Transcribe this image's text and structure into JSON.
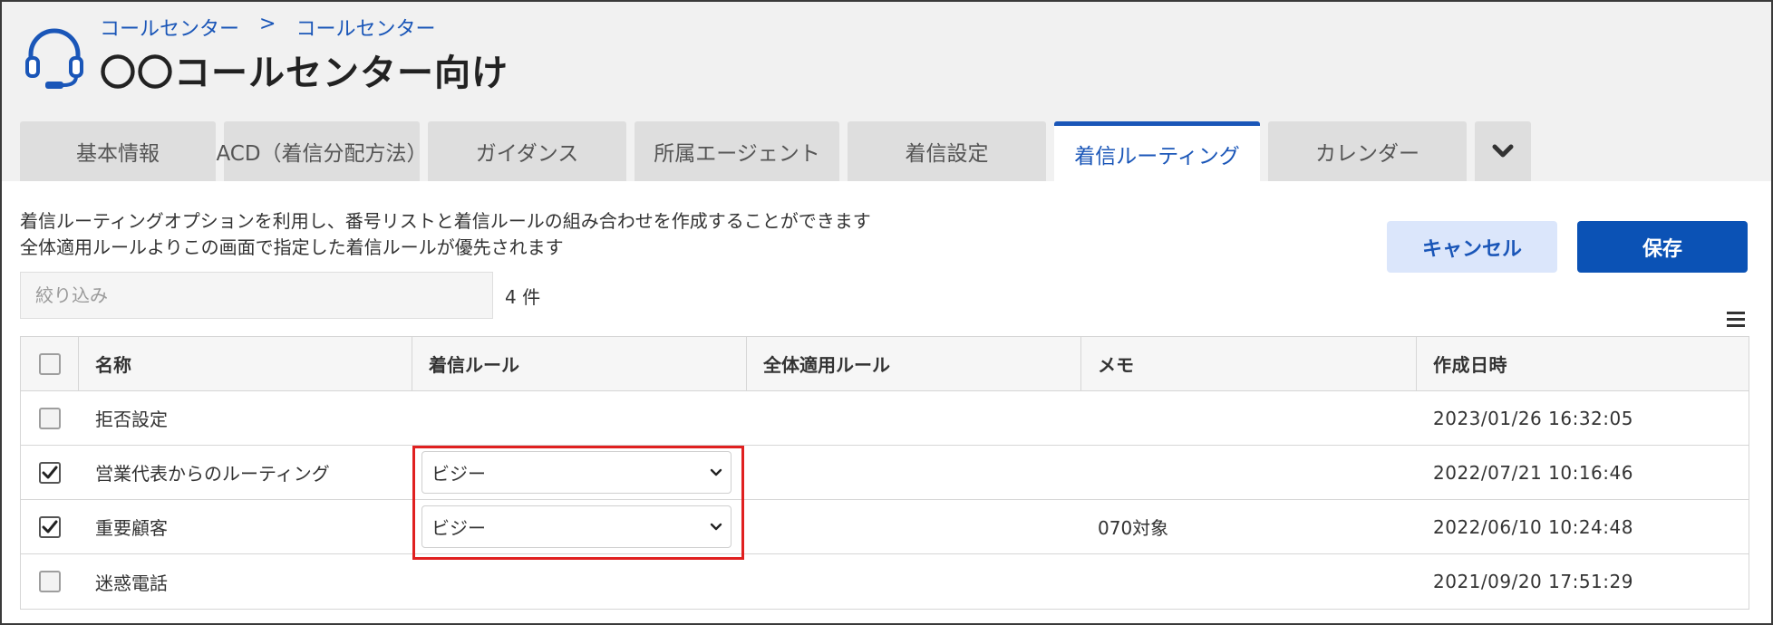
{
  "breadcrumb": [
    "コールセンター",
    "コールセンター"
  ],
  "breadcrumb_separator": ">",
  "page_title": "〇〇コールセンター向け",
  "tabs": [
    {
      "label": "基本情報",
      "active": false
    },
    {
      "label": "ACD（着信分配方法）",
      "active": false
    },
    {
      "label": "ガイダンス",
      "active": false
    },
    {
      "label": "所属エージェント",
      "active": false
    },
    {
      "label": "着信設定",
      "active": false
    },
    {
      "label": "着信ルーティング",
      "active": true
    },
    {
      "label": "カレンダー",
      "active": false
    }
  ],
  "description": [
    "着信ルーティングオプションを利用し、番号リストと着信ルールの組み合わせを作成することができます",
    "全体適用ルールよりこの画面で指定した着信ルールが優先されます"
  ],
  "buttons": {
    "cancel": "キャンセル",
    "save": "保存"
  },
  "filter": {
    "placeholder": "絞り込み",
    "value": ""
  },
  "count_label": "4 件",
  "table": {
    "headers": {
      "name": "名称",
      "rule": "着信ルール",
      "global_rule": "全体適用ルール",
      "memo": "メモ",
      "created": "作成日時"
    },
    "rows": [
      {
        "checked": false,
        "name": "拒否設定",
        "rule": "",
        "global_rule": "",
        "memo": "",
        "created": "2023/01/26 16:32:05"
      },
      {
        "checked": true,
        "name": "営業代表からのルーティング",
        "rule": "ビジー",
        "global_rule": "",
        "memo": "",
        "created": "2022/07/21 10:16:46"
      },
      {
        "checked": true,
        "name": "重要顧客",
        "rule": "ビジー",
        "global_rule": "",
        "memo": "070対象",
        "created": "2022/06/10 10:24:48"
      },
      {
        "checked": false,
        "name": "迷惑電話",
        "rule": "",
        "global_rule": "",
        "memo": "",
        "created": "2021/09/20 17:51:29"
      }
    ]
  },
  "colors": {
    "accent": "#1a56b8",
    "save_button": "#0b52b5",
    "cancel_button_bg": "#dbe6fb",
    "highlight": "#e02020"
  },
  "icons": {
    "app": "headset-icon",
    "tab_more": "chevron-down-icon",
    "column_menu": "hamburger-menu-icon",
    "select": "chevron-down-icon",
    "checkbox_checked": "checkmark-icon"
  }
}
